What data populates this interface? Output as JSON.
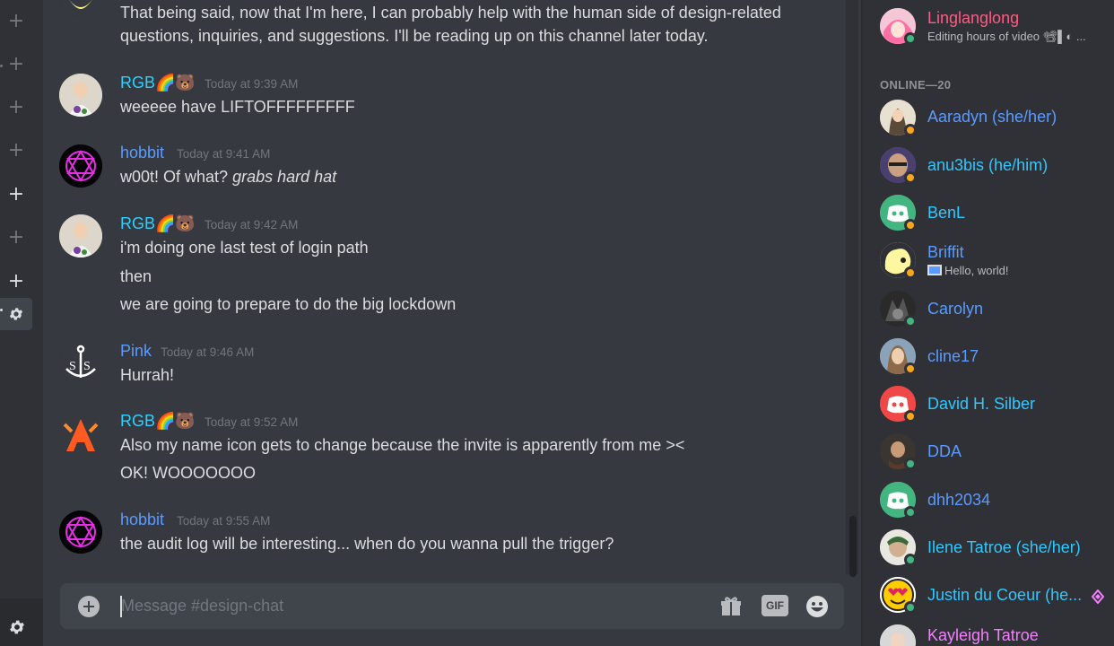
{
  "composer": {
    "placeholder": "Message #design-chat",
    "gift_icon": "gift-icon",
    "gif_label": "GIF",
    "emoji_icon": "emoji-icon"
  },
  "rail": {
    "icons": [
      "add-icon",
      "add-icon",
      "add-icon",
      "add-icon",
      "add-icon",
      "add-icon",
      "add-icon",
      "gear-icon",
      "gear-icon"
    ]
  },
  "messages": [
    {
      "author": "",
      "time": "",
      "lines": [
        "That being said, now that I'm here, I can probably help with the human side of design-related",
        "questions, inquiries, and suggestions. I'll be reading up on this channel later today."
      ]
    },
    {
      "author": "RGB🌈🐻",
      "time": "Today at 9:39 AM",
      "lines": [
        "weeeee have LIFTOFFFFFFFFF"
      ]
    },
    {
      "author": "hobbit",
      "time": "Today at 9:41 AM",
      "lines": [
        "w00t!  Of what?"
      ],
      "italic": "grabs hard hat"
    },
    {
      "author": "RGB🌈🐻",
      "time": "Today at 9:42 AM",
      "lines": [
        "i'm doing one last test of login path",
        "then",
        "we are going to prepare to do the big lockdown"
      ]
    },
    {
      "author": "Pink",
      "time": "Today at 9:46 AM",
      "lines": [
        "Hurrah!"
      ]
    },
    {
      "author": "RGB🌈🐻",
      "time": "Today at 9:52 AM",
      "lines": [
        "Also my name icon gets to change because the invite is apparently from me ><",
        "OK! WOOOOOOO"
      ]
    },
    {
      "author": "hobbit",
      "time": "Today at 9:55 AM",
      "lines": [
        "the audit log will be interesting...  when do you wanna pull the trigger?"
      ]
    }
  ],
  "members": {
    "top": {
      "name": "Linglanglong",
      "status": "Editing hours of video",
      "status_suffix": "📽▌◐ ..."
    },
    "online_header": "ONLINE—20",
    "list": [
      {
        "name": "Aaradyn (she/her)",
        "sub": "",
        "presence": "idle",
        "color": "#5b9bff"
      },
      {
        "name": "anu3bis (he/him)",
        "sub": "",
        "presence": "idle",
        "color": "#30c8ff"
      },
      {
        "name": "BenL",
        "sub": "",
        "presence": "idle",
        "color": "#30c8ff"
      },
      {
        "name": "Briffit",
        "sub": "Hello, world!",
        "presence": "idle",
        "color": "#5b9bff"
      },
      {
        "name": "Carolyn",
        "sub": "",
        "presence": "online",
        "color": "#5b9bff"
      },
      {
        "name": "cline17",
        "sub": "",
        "presence": "idle",
        "color": "#5b9bff"
      },
      {
        "name": "David H. Silber",
        "sub": "",
        "presence": "idle",
        "color": "#30c8ff"
      },
      {
        "name": "DDA",
        "sub": "",
        "presence": "online",
        "color": "#5b9bff"
      },
      {
        "name": "dhh2034",
        "sub": "",
        "presence": "online",
        "color": "#5b9bff"
      },
      {
        "name": "Ilene Tatroe (she/her)",
        "sub": "",
        "presence": "online",
        "color": "#30c8ff"
      },
      {
        "name": "Justin du Coeur (he...",
        "sub": "",
        "presence": "online",
        "color": "#30c8ff"
      },
      {
        "name": "Kayleigh Tatroe",
        "sub": "",
        "presence": "online",
        "color": "#f47fff"
      }
    ]
  }
}
